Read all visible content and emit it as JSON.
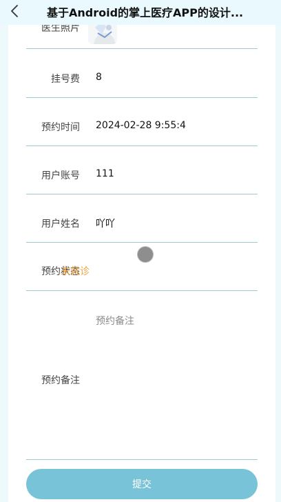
{
  "header": {
    "title": "基于Android的掌上医疗APP的设计...",
    "back_icon": "chevron-left-icon"
  },
  "form": {
    "doctor_photo_label": "医生照片",
    "fee": {
      "label": "挂号费",
      "value": "8"
    },
    "time": {
      "label": "预约时间",
      "value": "2024-02-28 9:55:4"
    },
    "account": {
      "label": "用户账号",
      "value": "111"
    },
    "name": {
      "label": "用户姓名",
      "value": "吖吖"
    },
    "status": {
      "label": "预约状态",
      "value": "未就诊",
      "color": "#f2a13c"
    },
    "note": {
      "label": "预约备注",
      "placeholder": "预约备注"
    }
  },
  "submit_label": "提交",
  "colors": {
    "background": "#eef9fc",
    "accent": "#79c3d8",
    "divider": "#9fc8d3"
  }
}
